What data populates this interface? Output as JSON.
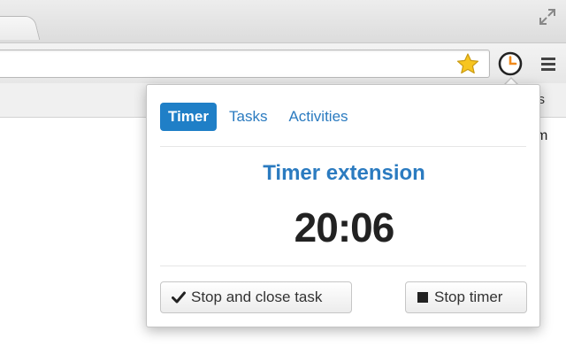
{
  "browser": {
    "bookmarks_bar_text": "rks",
    "page_text": "m",
    "icons": {
      "fullscreen": "fullscreen-icon",
      "bookmark_star": "star-icon",
      "extension": "clock-icon",
      "menu": "hamburger-menu-icon"
    },
    "colors": {
      "star": "#f7c520",
      "clock_hand": "#f08a1c"
    }
  },
  "popup": {
    "tabs": [
      {
        "label": "Timer",
        "active": true
      },
      {
        "label": "Tasks",
        "active": false
      },
      {
        "label": "Activities",
        "active": false
      }
    ],
    "title": "Timer extension",
    "timer": "20:06",
    "buttons": {
      "stop_close": {
        "label": "Stop and close task",
        "icon": "checkmark-icon"
      },
      "stop_timer": {
        "label": "Stop timer",
        "icon": "stop-square-icon"
      }
    },
    "colors": {
      "accent": "#1f7fc7",
      "link": "#2b7bc0",
      "text": "#222222"
    }
  }
}
